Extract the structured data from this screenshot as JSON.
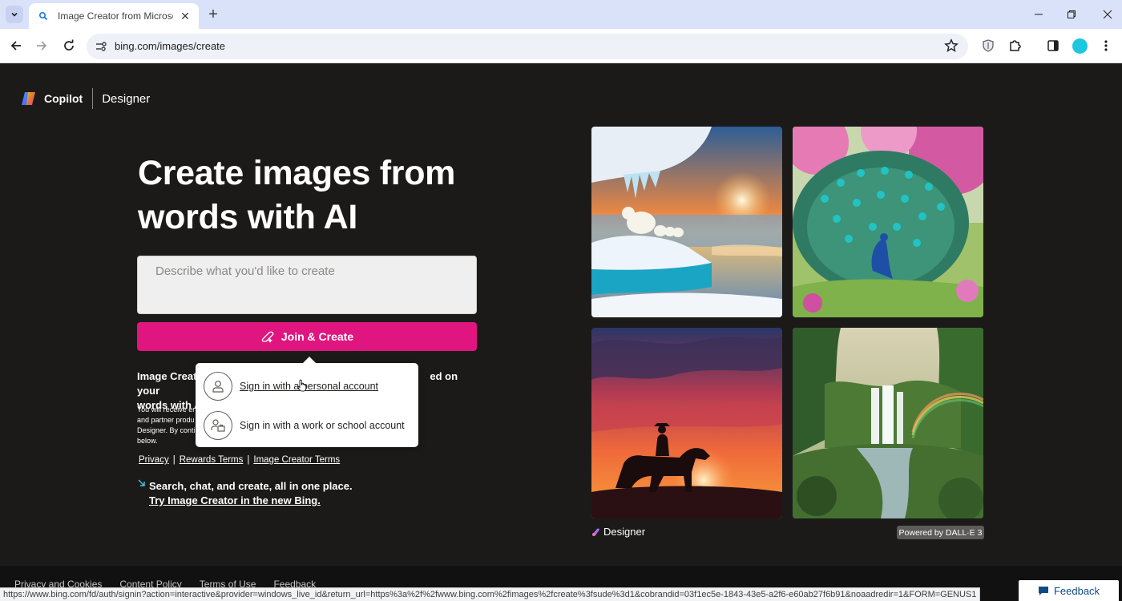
{
  "browser": {
    "tab_title": "Image Creator from Microsoft D",
    "address": "bing.com/images/create",
    "status_url": "https://www.bing.com/fd/auth/signin?action=interactive&provider=windows_live_id&return_url=https%3a%2f%2fwww.bing.com%2fimages%2fcreate%3fsude%3d1&cobrandid=03f1ec5e-1843-43e5-a2f6-e60ab27f6b91&noaadredir=1&FORM=GENUS1"
  },
  "brand": {
    "copilot": "Copilot",
    "designer": "Designer"
  },
  "hero": {
    "title": "Create images from words with AI"
  },
  "prompt": {
    "placeholder": "Describe what you'd like to create"
  },
  "join_button": "Join & Create",
  "disclaimer": {
    "title": "Image Creat                                        ed on your words with A",
    "title_part1": "Image Creato",
    "title_part2": "ed on your",
    "title_part3": "words with A",
    "body_line1": "You will receive er",
    "body_line2": "and partner produ",
    "body_line3": "Designer. By conti",
    "body_line4": "below."
  },
  "terms": {
    "privacy": "Privacy",
    "rewards": "Rewards Terms",
    "creator": "Image Creator Terms",
    "separator": "|"
  },
  "promo": {
    "text": "Search, chat, and create, all in one place.",
    "link": "Try Image Creator in the new Bing."
  },
  "signin": {
    "personal": "Sign in with a personal account",
    "work": "Sign in with a work or school account"
  },
  "gallery": {
    "brand": "Designer",
    "badge": "Powered by DALL·E 3"
  },
  "footer": {
    "links": [
      "Privacy and Cookies",
      "Content Policy",
      "Terms of Use",
      "Feedback"
    ],
    "feedback_button": "Feedback"
  },
  "colors": {
    "accent": "#e0157f",
    "page_bg": "#1b1a19"
  }
}
